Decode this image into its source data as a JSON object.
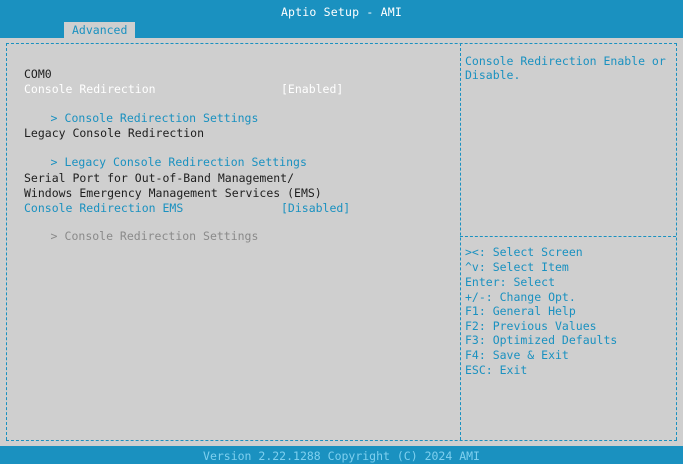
{
  "header": {
    "title": "Aptio Setup - AMI",
    "active_tab": "Advanced"
  },
  "left": {
    "section_com0": "COM0",
    "console_redirection": {
      "label": "Console Redirection",
      "value": "[Enabled]"
    },
    "console_redirection_settings": "Console Redirection Settings",
    "legacy_heading": "Legacy Console Redirection",
    "legacy_settings": "Legacy Console Redirection Settings",
    "oob_line1": "Serial Port for Out-of-Band Management/",
    "oob_line2": "Windows Emergency Management Services (EMS)",
    "ems": {
      "label": "Console Redirection EMS",
      "value": "[Disabled]"
    },
    "ems_settings": "Console Redirection Settings",
    "submenu_marker": ">"
  },
  "help": {
    "line1": "Console Redirection Enable or",
    "line2": "Disable.",
    "keys": [
      "><: Select Screen",
      "^v: Select Item",
      "Enter: Select",
      "+/-: Change Opt.",
      "F1: General Help",
      "F2: Previous Values",
      "F3: Optimized Defaults",
      "F4: Save & Exit",
      "ESC: Exit"
    ]
  },
  "footer": {
    "version": "Version 2.22.1288 Copyright (C) 2024 AMI"
  },
  "colors": {
    "accent": "#1a91c0",
    "background": "#cfcfcf",
    "selected_text": "#ffffff",
    "disabled_text": "#8a8a8a"
  }
}
